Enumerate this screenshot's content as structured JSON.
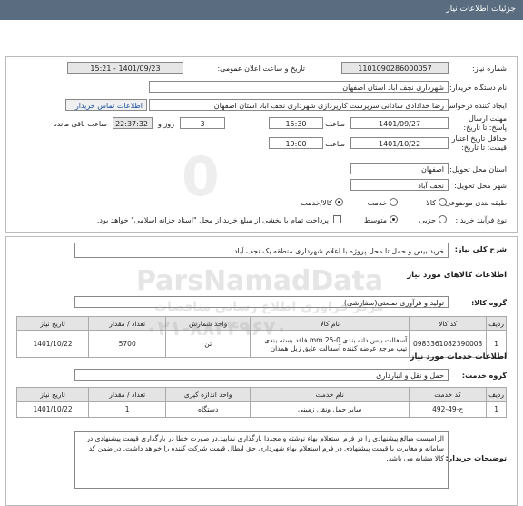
{
  "header": {
    "title": "جزئیات اطلاعات نیاز"
  },
  "need_number": {
    "label": "شماره نیاز:",
    "value": "1101090286000057"
  },
  "announce": {
    "label": "تاریخ و ساعت اعلان عمومی:",
    "value": "1401/09/23 - 15:21"
  },
  "buyer": {
    "label": "نام دستگاه خریدار:",
    "value": "شهرداری نجف اباد استان اصفهان"
  },
  "creator": {
    "label": "ایجاد کننده درخواست:",
    "value": "رضا خدادادی سادانی سرپرست  کارپردازی شهرداری نجف اباد استان اصفهان",
    "contact_button": "اطلاعات تماس خریدار"
  },
  "deadline": {
    "label": "مهلت ارسال پاسخ: تا تاریخ:",
    "date": "1401/09/27",
    "time_label": "ساعت",
    "time": "15:30",
    "days": "3",
    "days_label": "روز و",
    "remaining": "22:37:32",
    "remaining_label": "ساعت باقی مانده"
  },
  "validity": {
    "label": "حداقل تاریخ اعتبار قیمت: تا تاریخ:",
    "date": "1401/10/22",
    "time_label": "ساعت",
    "time": "19:00"
  },
  "province": {
    "label": "استان محل تحویل:",
    "value": "اصفهان"
  },
  "city": {
    "label": "شهر محل تحویل:",
    "value": "نجف آباد"
  },
  "category": {
    "label": "طبقه بندی موضوعی:",
    "options": [
      "کالا",
      "خدمت",
      "کالا/خدمت"
    ]
  },
  "process": {
    "label": "نوع فرآیند خرید :",
    "options": [
      "جزیی",
      "متوسط"
    ],
    "payment_note": "پرداخت تمام یا بخشی از مبلغ خرید،از محل \"اسناد خزانه اسلامی\" خواهد بود."
  },
  "summary": {
    "label": "شرح کلی نیاز:",
    "value": "خرید بیس و حمل تا محل پروژه با اعلام شهرداری منطقه یک نجف آباد."
  },
  "goods": {
    "section_title": "اطلاعات کالاهای مورد نیاز",
    "group_label": "گروه کالا:",
    "group_value": "تولید و فرآوری صنعتی(سفارشی)",
    "headers": [
      "ردیف",
      "کد کالا",
      "نام کالا",
      "واحد شمارش",
      "تعداد / مقدار",
      "تاریخ نیاز"
    ],
    "rows": [
      {
        "idx": "1",
        "code": "0983361082390003",
        "name": "آسفالت بیس دانه بندی 0-25 mm فاقد بسته بندی تیپ مرجع عرضه کننده آسفالت عایق زیل همدان",
        "unit": "تن",
        "qty": "5700",
        "date": "1401/10/22"
      }
    ]
  },
  "services": {
    "section_title": "اطلاعات خدمات مورد نیاز",
    "group_label": "گروه خدمت:",
    "group_value": "حمل و نقل و انبارداری",
    "headers": [
      "ردیف",
      "کد خدمت",
      "نام خدمت",
      "واحد اندازه گیری",
      "تعداد / مقدار",
      "تاریخ نیاز"
    ],
    "rows": [
      {
        "idx": "1",
        "code": "ح-49-492",
        "name": "سایر حمل ونقل زمینی",
        "unit": "دستگاه",
        "qty": "1",
        "date": "1401/10/22"
      }
    ]
  },
  "notes": {
    "label": "توضیحات خریدار:",
    "value": "الزامیست مبالغ پیشنهادی را در فرم استعلام بهاء نوشته و مجددا بارگذاری نمایید.در صورت خطا در بارگذاری قیمت پیشنهادی در سامانه و مغایرت با قیمت پیشنهادی در فرم استعلام بهاء شهرداری حق ابطال قیمت شرکت کننده را خواهد داشت. در ضمن کد کالا مشابه می باشد."
  },
  "watermark": {
    "text": "ParsNamadData",
    "sub": "مرکز فراوری اطلاع رسانی مناقصات",
    "phone": "۰۲۱-۸۸۳۴۹۶۷۰"
  }
}
